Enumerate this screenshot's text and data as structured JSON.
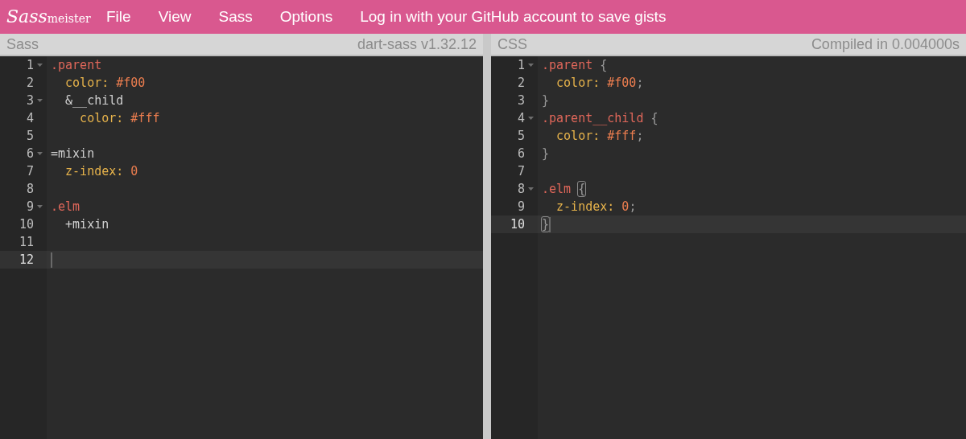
{
  "logo": {
    "script": "Sass",
    "wordmark": "meister"
  },
  "menu": [
    "File",
    "View",
    "Sass",
    "Options",
    "Log in with your GitHub account to save gists"
  ],
  "panels": [
    {
      "title": "Sass",
      "info": "dart-sass v1.32.12",
      "lines": [
        {
          "number": "1",
          "foldable": true,
          "active": false,
          "tokens": [
            {
              "text": ".parent",
              "kind": "selector"
            }
          ]
        },
        {
          "number": "2",
          "foldable": false,
          "active": false,
          "tokens": [
            {
              "text": "  color:",
              "kind": "property"
            },
            {
              "text": " #f00",
              "kind": "value"
            }
          ]
        },
        {
          "number": "3",
          "foldable": true,
          "active": false,
          "tokens": [
            {
              "text": "  &__child",
              "kind": "plain"
            }
          ]
        },
        {
          "number": "4",
          "foldable": false,
          "active": false,
          "tokens": [
            {
              "text": "    color:",
              "kind": "property"
            },
            {
              "text": " #fff",
              "kind": "value"
            }
          ]
        },
        {
          "number": "5",
          "foldable": false,
          "active": false
        },
        {
          "number": "6",
          "foldable": true,
          "active": false,
          "tokens": [
            {
              "text": "=mixin",
              "kind": "plain"
            }
          ]
        },
        {
          "number": "7",
          "foldable": false,
          "active": false,
          "tokens": [
            {
              "text": "  z-index:",
              "kind": "property"
            },
            {
              "text": " 0",
              "kind": "value"
            }
          ]
        },
        {
          "number": "8",
          "foldable": false,
          "active": false
        },
        {
          "number": "9",
          "foldable": true,
          "active": false,
          "tokens": [
            {
              "text": ".elm",
              "kind": "selector"
            }
          ]
        },
        {
          "number": "10",
          "foldable": false,
          "active": false,
          "tokens": [
            {
              "text": "  +mixin",
              "kind": "plain"
            }
          ]
        },
        {
          "number": "11",
          "foldable": false,
          "active": false
        },
        {
          "number": "12",
          "foldable": false,
          "active": true
        }
      ]
    },
    {
      "title": "CSS",
      "info": "Compiled in 0.004000s",
      "lines": [
        {
          "number": "1",
          "foldable": true,
          "active": false,
          "tokens": [
            {
              "text": ".parent",
              "kind": "selector"
            },
            {
              "text": " {",
              "kind": "punct"
            }
          ]
        },
        {
          "number": "2",
          "foldable": false,
          "active": false,
          "tokens": [
            {
              "text": "  color:",
              "kind": "property"
            },
            {
              "text": " #f00",
              "kind": "value"
            },
            {
              "text": ";",
              "kind": "punct"
            }
          ]
        },
        {
          "number": "3",
          "foldable": false,
          "active": false,
          "tokens": [
            {
              "text": "}",
              "kind": "punct"
            }
          ]
        },
        {
          "number": "4",
          "foldable": true,
          "active": false,
          "tokens": [
            {
              "text": ".parent__child",
              "kind": "selector"
            },
            {
              "text": " {",
              "kind": "punct"
            }
          ]
        },
        {
          "number": "5",
          "foldable": false,
          "active": false,
          "tokens": [
            {
              "text": "  color:",
              "kind": "property"
            },
            {
              "text": " #fff",
              "kind": "value"
            },
            {
              "text": ";",
              "kind": "punct"
            }
          ]
        },
        {
          "number": "6",
          "foldable": false,
          "active": false,
          "tokens": [
            {
              "text": "}",
              "kind": "punct"
            }
          ]
        },
        {
          "number": "7",
          "foldable": false,
          "active": false
        },
        {
          "number": "8",
          "foldable": true,
          "active": false,
          "tokens": [
            {
              "text": ".elm ",
              "kind": "selector"
            },
            {
              "text": "{",
              "kind": "bracket_match"
            }
          ]
        },
        {
          "number": "9",
          "foldable": false,
          "active": false,
          "tokens": [
            {
              "text": "  z-index:",
              "kind": "property"
            },
            {
              "text": " 0",
              "kind": "value"
            },
            {
              "text": ";",
              "kind": "punct"
            }
          ]
        },
        {
          "number": "10",
          "foldable": false,
          "active": true,
          "tokens": [
            {
              "text": "}",
              "kind": "bracket_match"
            }
          ]
        }
      ]
    }
  ]
}
